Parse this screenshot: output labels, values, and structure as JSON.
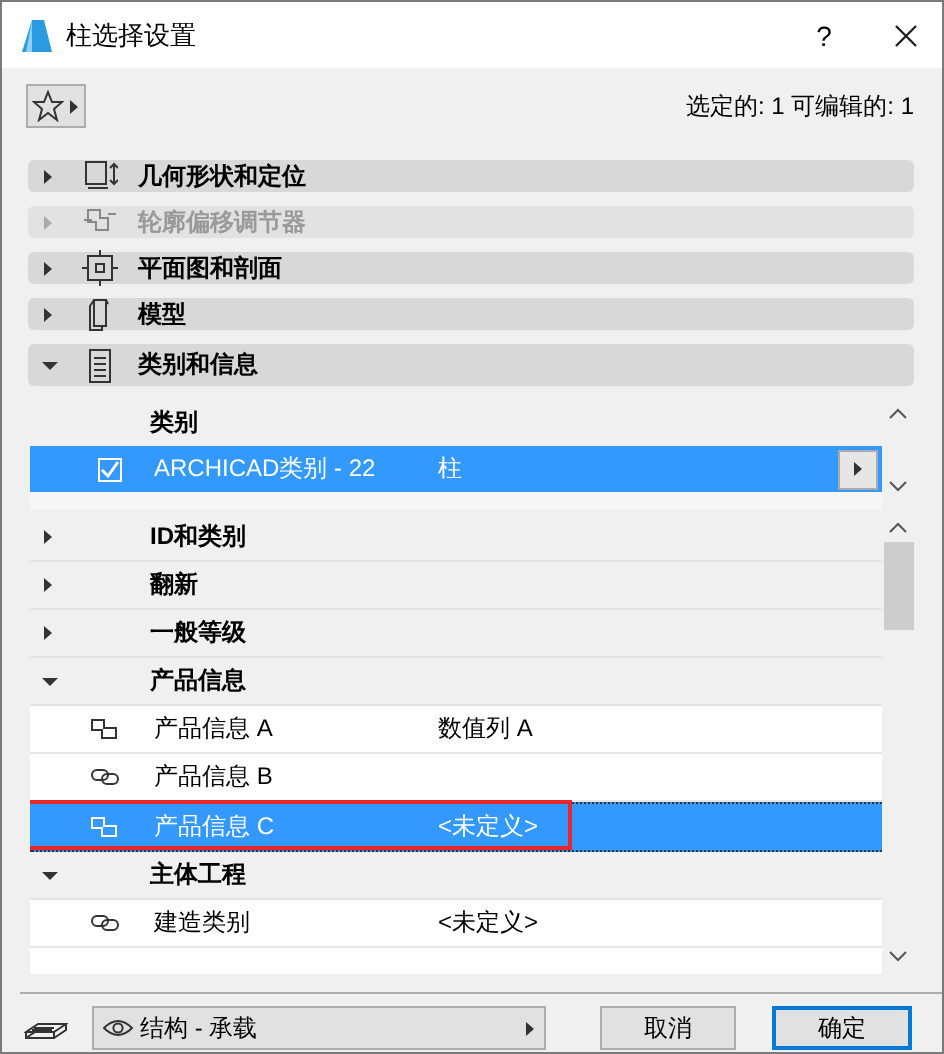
{
  "window": {
    "title": "柱选择设置",
    "help": "?"
  },
  "toolbar": {
    "counter": "选定的: 1 可编辑的: 1"
  },
  "panels": [
    {
      "label": "几何形状和定位",
      "expanded": false,
      "disabled": false
    },
    {
      "label": "轮廓偏移调节器",
      "expanded": false,
      "disabled": true
    },
    {
      "label": "平面图和剖面",
      "expanded": false,
      "disabled": false
    },
    {
      "label": "模型",
      "expanded": false,
      "disabled": false
    },
    {
      "label": "类别和信息",
      "expanded": true,
      "disabled": false
    }
  ],
  "classification": {
    "header": "类别",
    "rows": [
      {
        "checked": true,
        "selected": true,
        "name": "ARCHICAD类别 - 22",
        "value": "柱"
      }
    ]
  },
  "properties": [
    {
      "label": "ID和类别",
      "expanded": false
    },
    {
      "label": "翻新",
      "expanded": false
    },
    {
      "label": "一般等级",
      "expanded": false
    },
    {
      "label": "产品信息",
      "expanded": true,
      "children": [
        {
          "label": "产品信息 A",
          "value": "数值列 A",
          "linked": false,
          "selected": false,
          "highlighted": false
        },
        {
          "label": "产品信息 B",
          "linked": true,
          "selected": false,
          "highlighted": false
        },
        {
          "label": "产品信息 C",
          "value": "<未定义>",
          "linked": false,
          "selected": true,
          "highlighted": true
        }
      ]
    },
    {
      "label": "主体工程",
      "expanded": true,
      "children": [
        {
          "label": "建造类别",
          "value": "<未定义>",
          "linked": true,
          "selected": false,
          "highlighted": false
        }
      ]
    }
  ],
  "footer": {
    "layer": "结构 - 承载",
    "buttons": [
      {
        "label": "取消",
        "default": false
      },
      {
        "label": "确定",
        "default": true
      }
    ]
  }
}
